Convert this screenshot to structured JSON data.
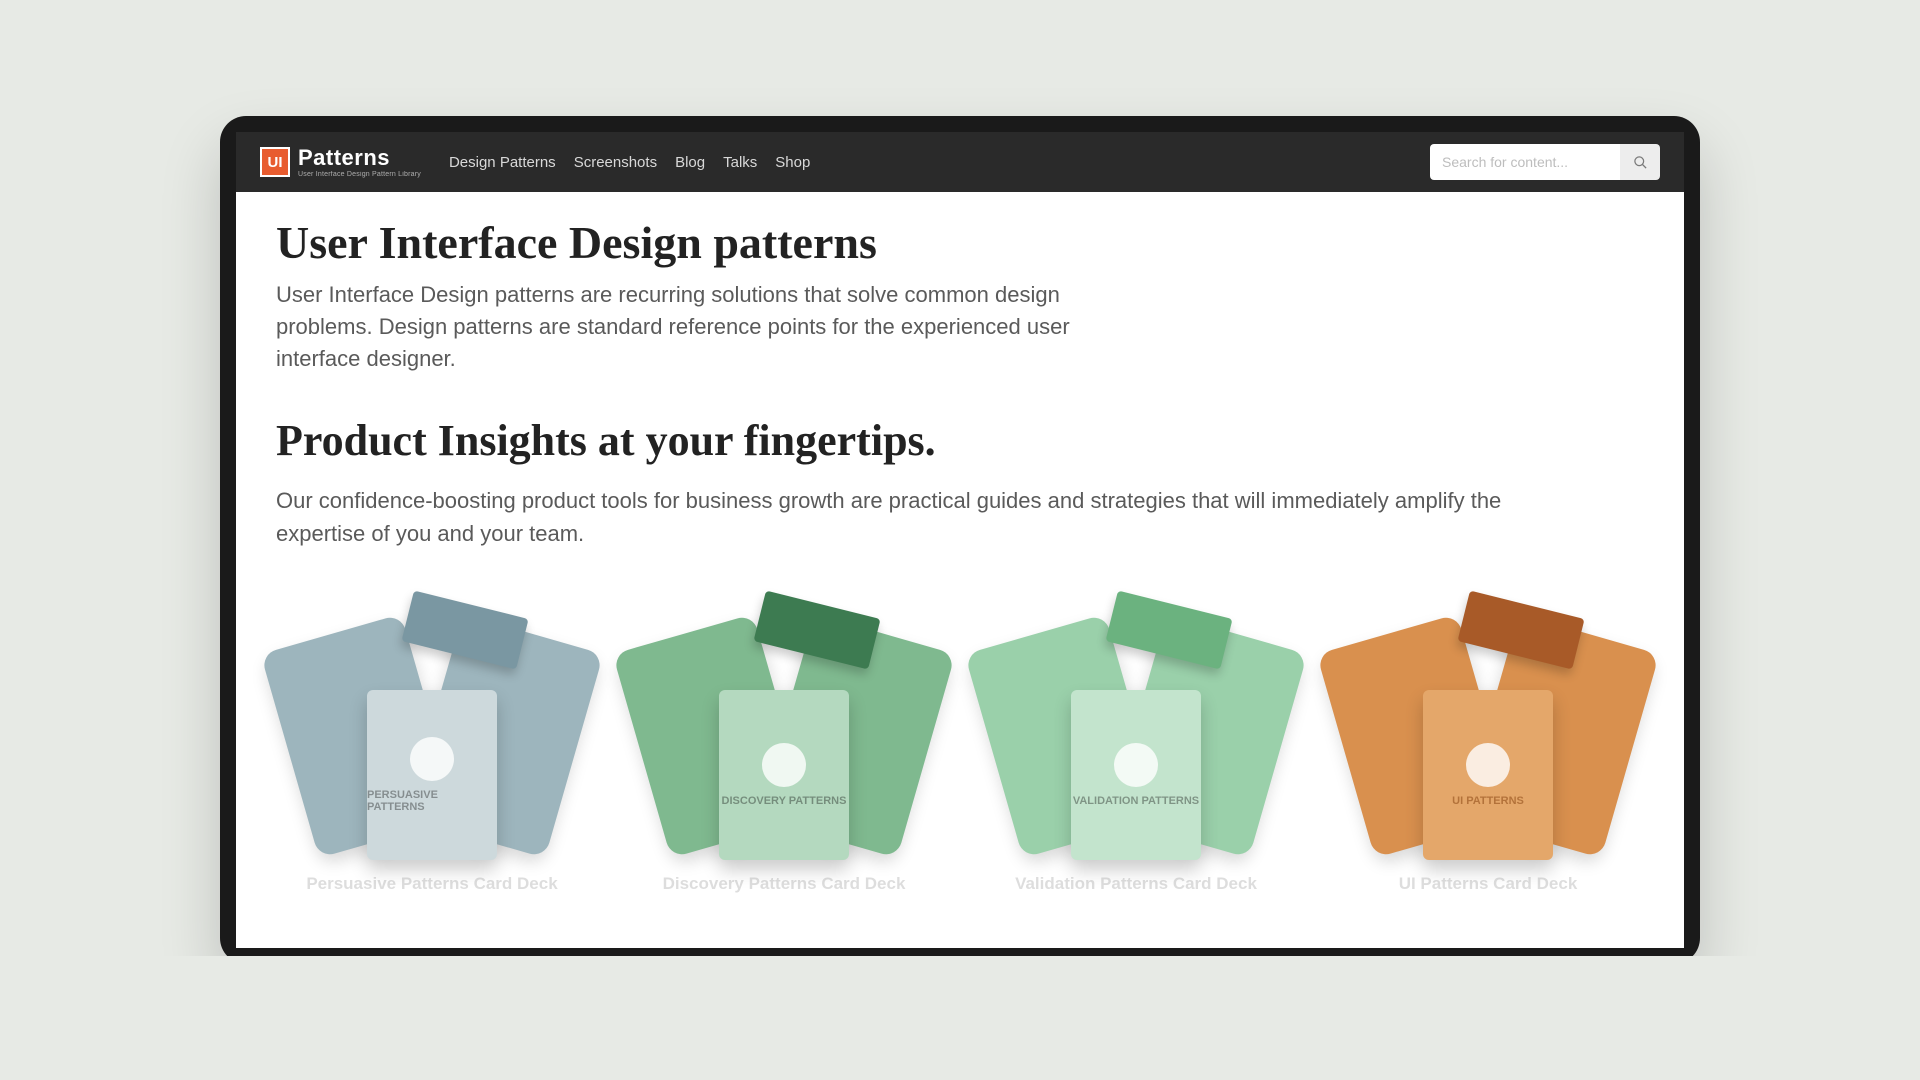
{
  "brand": {
    "badge": "UI",
    "title": "Patterns",
    "subtitle": "User Interface Design Pattern Library"
  },
  "nav": [
    "Design Patterns",
    "Screenshots",
    "Blog",
    "Talks",
    "Shop"
  ],
  "search": {
    "placeholder": "Search for content..."
  },
  "hero": {
    "title": "User Interface Design patterns",
    "subtitle": "User Interface Design patterns are recurring solutions that solve common design problems. Design patterns are standard reference points for the experienced user interface designer."
  },
  "section": {
    "title": "Product Insights at your fingertips.",
    "subtitle": "Our confidence-boosting product tools for business growth are practical guides and strategies that will immediately amplify the expertise of you and your team."
  },
  "products": [
    {
      "name": "Persuasive Patterns Card Deck",
      "theme": "theme-blue",
      "box_label": "PERSUASIVE PATTERNS"
    },
    {
      "name": "Discovery Patterns Card Deck",
      "theme": "theme-green",
      "box_label": "DISCOVERY PATTERNS"
    },
    {
      "name": "Validation Patterns Card Deck",
      "theme": "theme-green2",
      "box_label": "VALIDATION PATTERNS"
    },
    {
      "name": "UI Patterns Card Deck",
      "theme": "theme-orange",
      "box_label": "UI PATTERNS"
    }
  ]
}
